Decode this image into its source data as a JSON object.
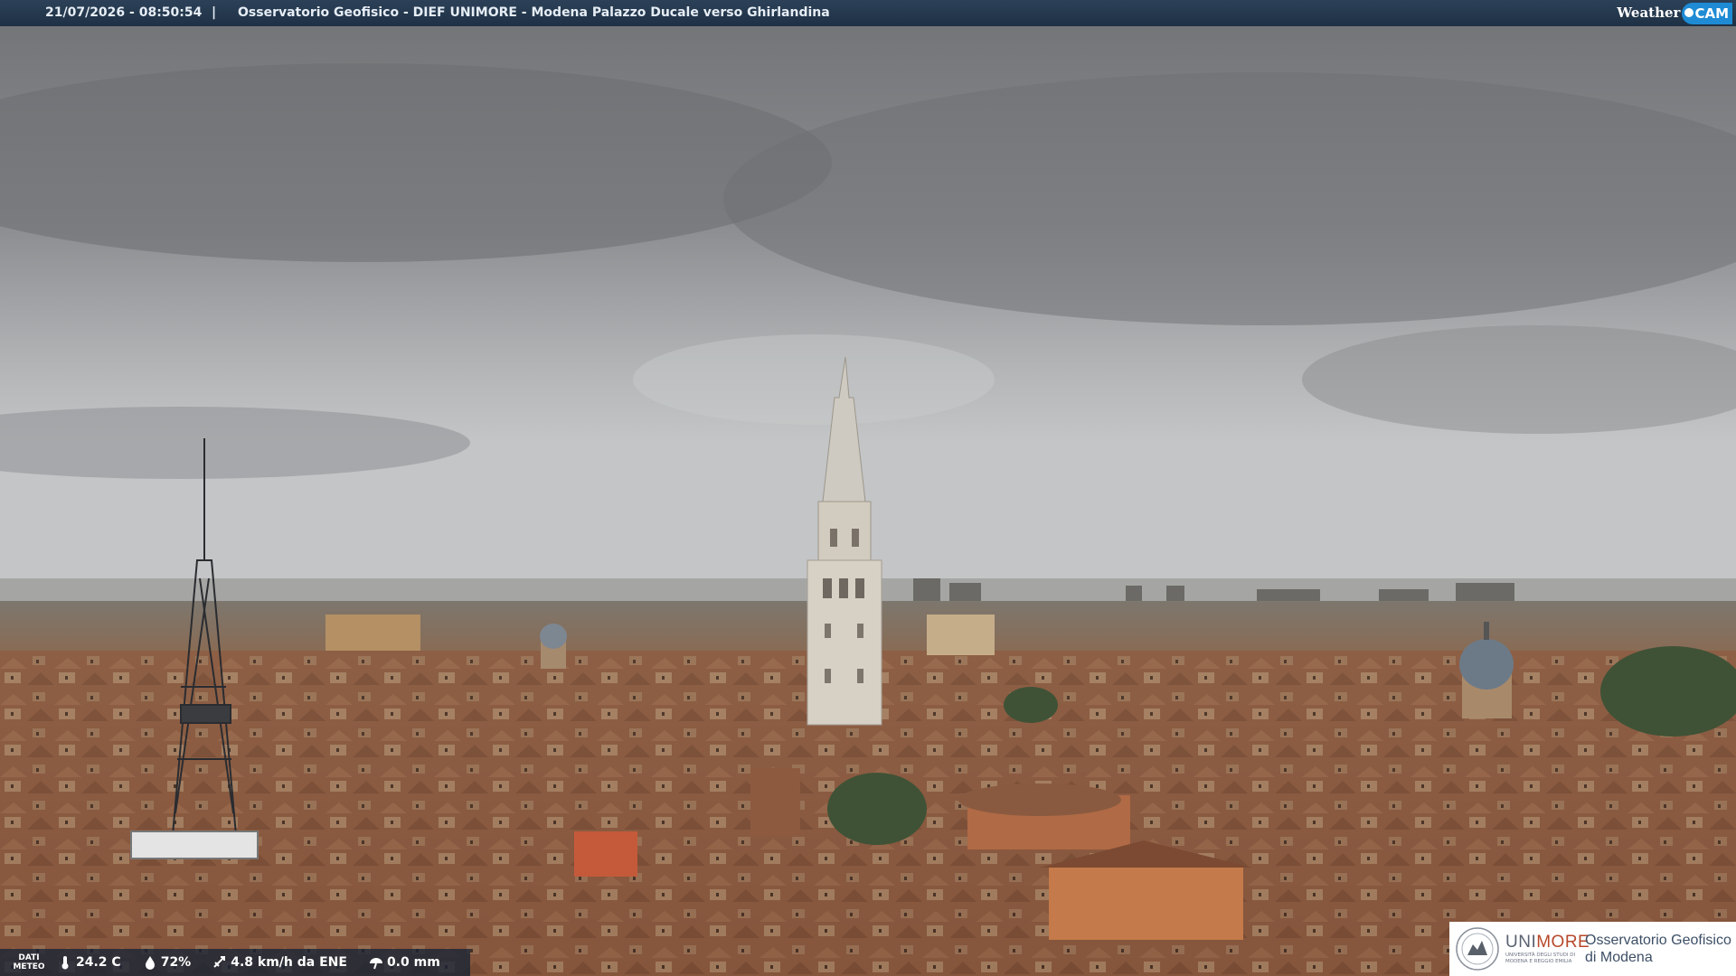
{
  "overlay": {
    "timestamp": "21/07/2026 - 08:50:54",
    "separator": "|",
    "camera_title": "Osservatorio Geofisico - DIEF UNIMORE - Modena Palazzo Ducale verso Ghirlandina"
  },
  "brand": {
    "weather": "Weather",
    "cam": "CAM"
  },
  "meteo": {
    "label_line1": "DATI",
    "label_line2": "METEO",
    "temperature": "24.2 C",
    "humidity": "72%",
    "wind": "4.8 km/h da ENE",
    "rain": "0.0 mm",
    "icons": [
      "thermometer-icon",
      "humidity-drop-icon",
      "wind-icon",
      "rain-gauge-icon"
    ]
  },
  "logo": {
    "university": "UNI",
    "university_accent": "MORE",
    "university_sub1": "UNIVERSITÀ DEGLI STUDI DI",
    "university_sub2": "MODENA E REGGIO EMILIA",
    "observatory_line1": "Osservatorio Geofisico",
    "observatory_line2": "di Modena"
  },
  "colors": {
    "sky": "#a7a9ab",
    "roof": "#8d5a3e",
    "tower": "#d9d3c8",
    "bar": "#1f3146",
    "brand_blue": "#1e8bd4",
    "unimore_red": "#b7482a"
  }
}
